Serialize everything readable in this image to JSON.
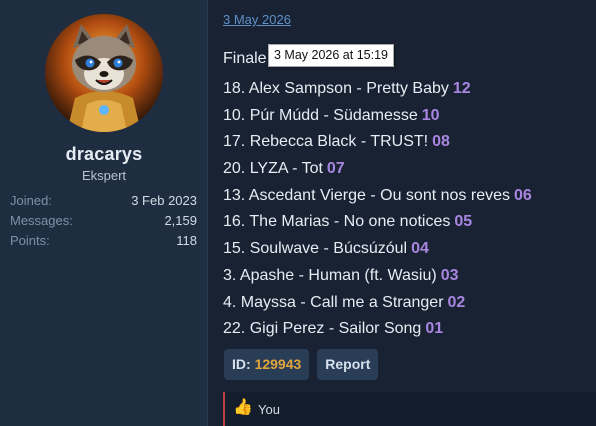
{
  "user": {
    "name": "dracarys",
    "title": "Ekspert",
    "stats": [
      {
        "label": "Joined:",
        "value": "3 Feb 2023"
      },
      {
        "label": "Messages:",
        "value": "2,159"
      },
      {
        "label": "Points:",
        "value": "118"
      }
    ]
  },
  "post": {
    "date": "3 May 2026",
    "tooltip": "3 May 2026 at 15:19",
    "heading": "Finale",
    "entries": [
      {
        "text": "18. Alex Sampson - Pretty Baby",
        "points": "12"
      },
      {
        "text": "10. Púr Múdd - Südamesse",
        "points": "10"
      },
      {
        "text": "17. Rebecca Black - TRUST!",
        "points": "08"
      },
      {
        "text": "20. LYZA - Tot",
        "points": "07"
      },
      {
        "text": "13. Ascedant Vierge - Ou sont nos reves",
        "points": "06"
      },
      {
        "text": "16. The Marias - No one notices",
        "points": "05"
      },
      {
        "text": "15. Soulwave - Búcsúzóul",
        "points": "04"
      },
      {
        "text": "3. Apashe - Human (ft. Wasiu)",
        "points": "03"
      },
      {
        "text": "4. Mayssa - Call me a Stranger",
        "points": "02"
      },
      {
        "text": "22. Gigi Perez - Sailor Song",
        "points": "01"
      }
    ]
  },
  "actions": {
    "id_label": "ID:",
    "id_value": "129943",
    "report_label": "Report"
  },
  "reactions": {
    "icon": "thumbs-up-icon",
    "text": "You"
  },
  "colors": {
    "accent_points": "#a886e0",
    "id_value": "#e0a53c",
    "link": "#5f90c8",
    "reaction_bar": "#c23f3f"
  }
}
